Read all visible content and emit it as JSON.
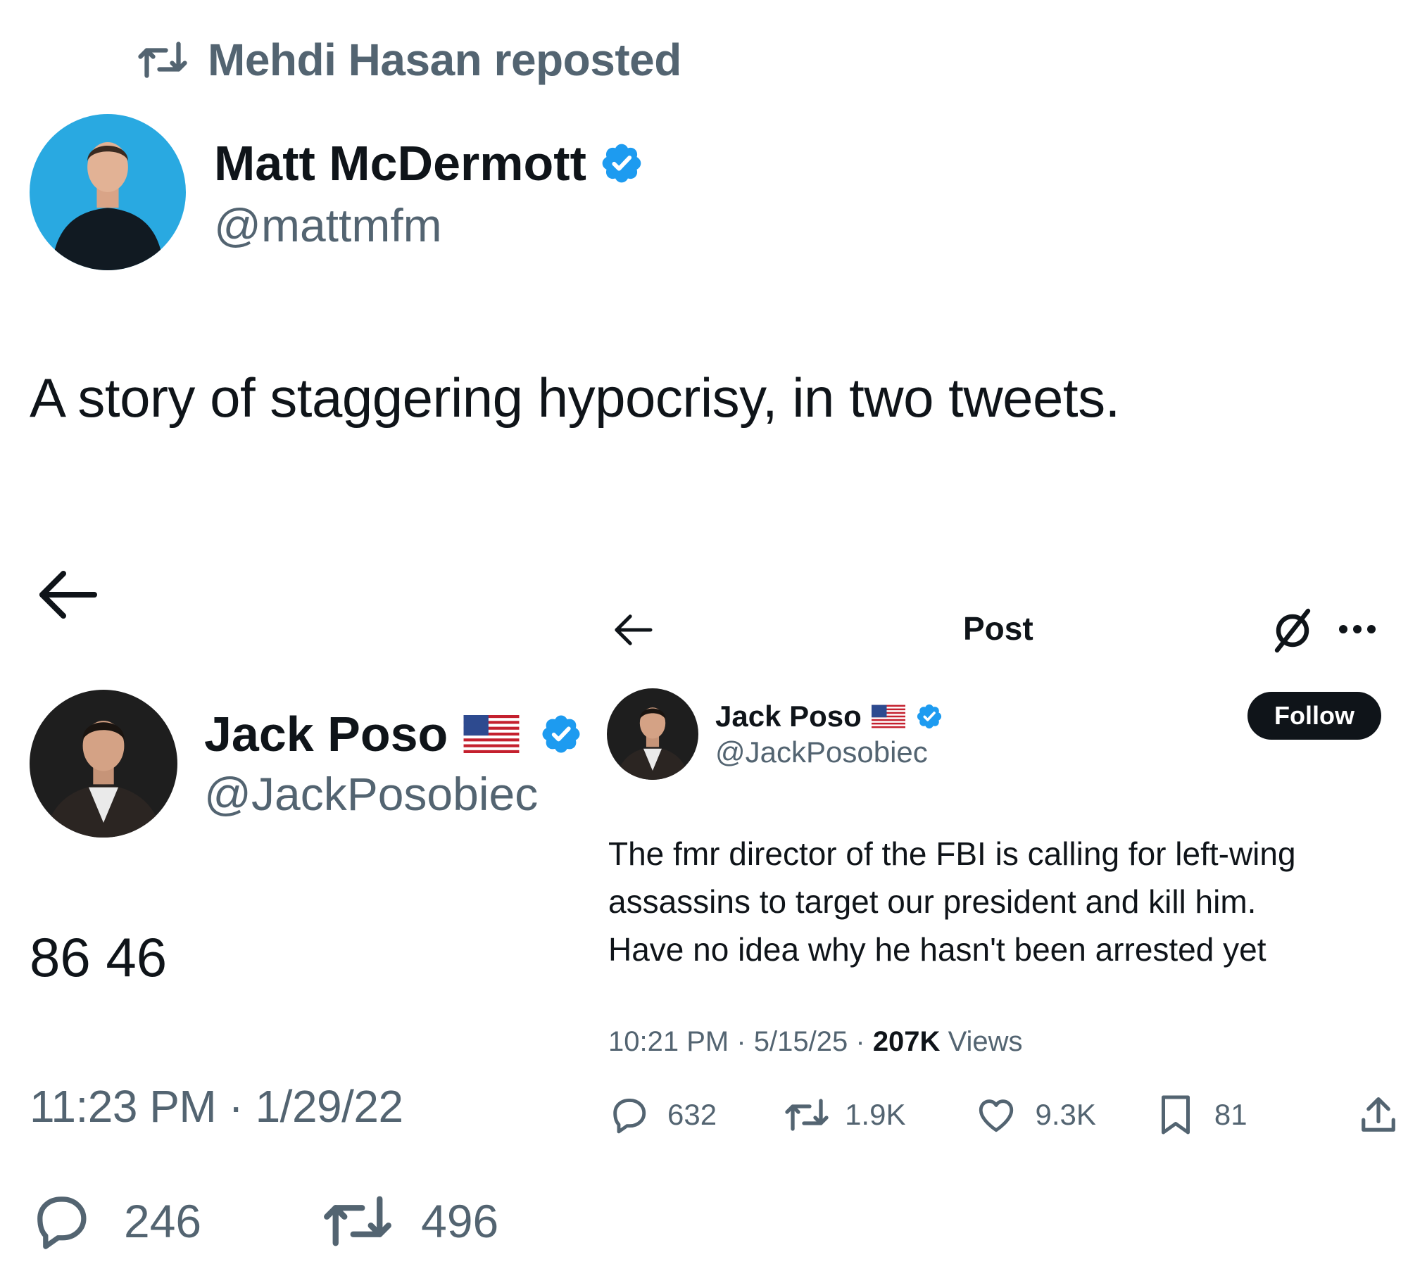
{
  "repost": {
    "label": "Mehdi Hasan reposted",
    "icon": "repost-icon"
  },
  "main_post": {
    "author_name": "Matt McDermott",
    "author_handle": "@mattmfm",
    "verified": true,
    "text": "A story of staggering hypocrisy, in two tweets.",
    "avatar_bg": "#1da1f2"
  },
  "left_screenshot": {
    "back_icon": "back-arrow-icon",
    "author_name": "Jack Poso",
    "author_handle": "@JackPosobiec",
    "flag_icon": "us-flag-icon",
    "verified": true,
    "text": "86 46",
    "timestamp": "11:23 PM · 1/29/22",
    "stats": {
      "replies": "246",
      "reposts": "496"
    }
  },
  "right_screenshot": {
    "header_title": "Post",
    "back_icon": "back-arrow-icon",
    "grok_icon": "grok-icon",
    "more_icon": "more-dots-icon",
    "author_name": "Jack Poso",
    "author_handle": "@JackPosobiec",
    "flag_icon": "us-flag-icon",
    "verified": true,
    "follow_label": "Follow",
    "text_lines": [
      "The fmr director of the FBI is calling for left-wing",
      "assassins to target our president and kill him.",
      "Have no idea why he hasn't been arrested yet"
    ],
    "time": "10:21 PM",
    "date": "5/15/25",
    "views_count": "207K",
    "views_label": "Views",
    "stats": {
      "replies": "632",
      "reposts": "1.9K",
      "likes": "9.3K",
      "bookmarks": "81"
    }
  },
  "colors": {
    "text": "#0f1419",
    "secondary": "#536471",
    "verified": "#1d9bf0",
    "follow_bg": "#0f1419"
  }
}
